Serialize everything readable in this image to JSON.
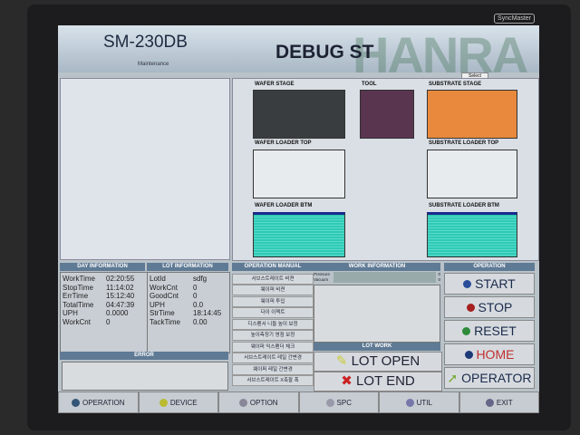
{
  "monitor": {
    "brand": "SyncMaster"
  },
  "header": {
    "model": "SM-230DB",
    "title": "DEBUG ST",
    "logo": "HANRA",
    "subtitle": "Maintenance",
    "select_label": "Select"
  },
  "stages": {
    "wafer_stage": "WAFER STAGE",
    "tool": "TOOL",
    "substrate_stage": "SUBSTRATE STAGE",
    "wafer_loader_top": "WAFER LOADER TOP",
    "substrate_loader_top": "SUBSTRATE LOADER TOP",
    "wafer_loader_btm": "WAFER LOADER BTM",
    "substrate_loader_btm": "SUBSTRATE LOADER BTM",
    "colors": {
      "wafer_stage": "#3a3d40",
      "tool": "#5a3550",
      "substrate_stage": "#e8893d",
      "loader": "#2fc9b5"
    }
  },
  "day_info": {
    "title": "DAY INFORMATION",
    "rows": [
      {
        "k": "WorkTime",
        "v": "02:20:55"
      },
      {
        "k": "StopTime",
        "v": "11:14:02"
      },
      {
        "k": "ErrTime",
        "v": "15:12:40"
      },
      {
        "k": "TotalTime",
        "v": "04:47:39"
      },
      {
        "k": "UPH",
        "v": "0.0000"
      },
      {
        "k": "WorkCnt",
        "v": "0"
      }
    ]
  },
  "lot_info": {
    "title": "LOT INFORMATION",
    "rows": [
      {
        "k": "LotId",
        "v": "sdfg"
      },
      {
        "k": "WorkCnt",
        "v": "0"
      },
      {
        "k": "GoodCnt",
        "v": "0"
      },
      {
        "k": "UPH",
        "v": "0.0"
      },
      {
        "k": "StrTime",
        "v": "18:14:45"
      },
      {
        "k": "TackTime",
        "v": "0.00"
      }
    ]
  },
  "error": {
    "title": "ERROR"
  },
  "manual": {
    "title": "OPERATION MANUAL",
    "items": [
      "서브스트레이트 비젼",
      "웨이퍼 비젼",
      "웨이퍼 투입",
      "다이 이젝트",
      "디스펜서 니들 높이 보정",
      "높이측정기 영점 보정",
      "웨이퍼 익스펜더 체크",
      "서브스트레이트 레일 간변경",
      "웨이퍼 레일 간변경",
      "서브스트레이트 X축팔 폭"
    ]
  },
  "work_info": {
    "title": "WORK INFORMATION",
    "pressure_label": "Pressure",
    "pressure_value": "0",
    "vacuum_label": "Vacuum",
    "vacuum_value": "0"
  },
  "lot_work": {
    "title": "LOT WORK",
    "open": "LOT OPEN",
    "end": "LOT END"
  },
  "operation": {
    "title": "OPERATION",
    "start": "START",
    "stop": "STOP",
    "reset": "RESET",
    "home": "HOME",
    "operator": "OPERATOR"
  },
  "tabs": [
    "OPERATION",
    "DEVICE",
    "OPTION",
    "SPC",
    "UTIL",
    "EXIT"
  ]
}
